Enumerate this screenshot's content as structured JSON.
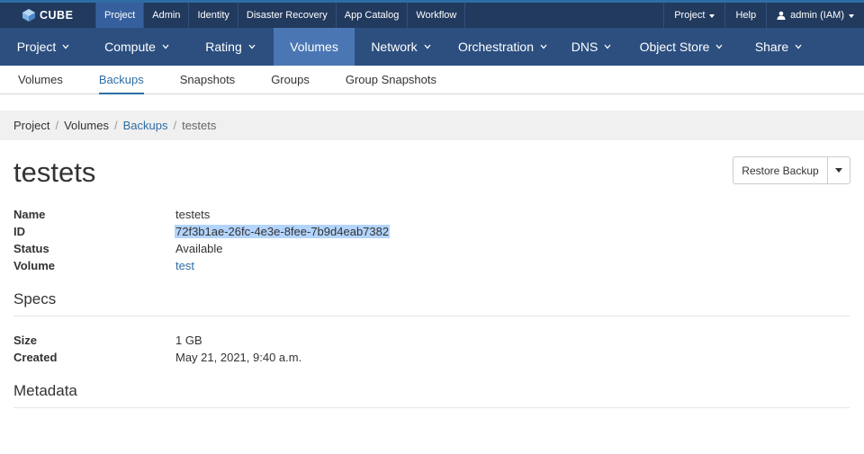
{
  "brand": {
    "name": "CUBE",
    "logo_icon": "cube-logo-icon"
  },
  "topnav": {
    "items": [
      {
        "label": "Project",
        "active": true
      },
      {
        "label": "Admin"
      },
      {
        "label": "Identity"
      },
      {
        "label": "Disaster Recovery"
      },
      {
        "label": "App Catalog"
      },
      {
        "label": "Workflow"
      }
    ],
    "right": {
      "project_menu": "Project",
      "help": "Help",
      "user": "admin (IAM)"
    }
  },
  "mainnav": {
    "items": [
      {
        "label": "Project",
        "dropdown": true
      },
      {
        "label": "Compute",
        "dropdown": true
      },
      {
        "label": "Rating",
        "dropdown": true
      },
      {
        "label": "Volumes",
        "dropdown": false,
        "active": true
      },
      {
        "label": "Network",
        "dropdown": true
      },
      {
        "label": "Orchestration",
        "dropdown": true
      },
      {
        "label": "DNS",
        "dropdown": true
      },
      {
        "label": "Object Store",
        "dropdown": true
      },
      {
        "label": "Share",
        "dropdown": true
      }
    ]
  },
  "subtabs": [
    {
      "label": "Volumes"
    },
    {
      "label": "Backups",
      "active": true
    },
    {
      "label": "Snapshots"
    },
    {
      "label": "Groups"
    },
    {
      "label": "Group Snapshots"
    }
  ],
  "breadcrumb": {
    "items": [
      "Project",
      "Volumes",
      "Backups",
      "testets"
    ],
    "separator": "/"
  },
  "page": {
    "title": "testets",
    "restore_button": "Restore Backup"
  },
  "overview": {
    "name_label": "Name",
    "name_value": "testets",
    "id_label": "ID",
    "id_value": "72f3b1ae-26fc-4e3e-8fee-7b9d4eab7382",
    "status_label": "Status",
    "status_value": "Available",
    "volume_label": "Volume",
    "volume_value": "test"
  },
  "specs": {
    "heading": "Specs",
    "size_label": "Size",
    "size_value": "1 GB",
    "created_label": "Created",
    "created_value": "May 21, 2021, 9:40 a.m."
  },
  "metadata": {
    "heading": "Metadata"
  },
  "colors": {
    "topbar": "#223a5e",
    "mainnav": "#2c4f80",
    "mainnav_active": "#4a77b4",
    "link": "#2e6da4",
    "selection": "#b3d4fc"
  }
}
